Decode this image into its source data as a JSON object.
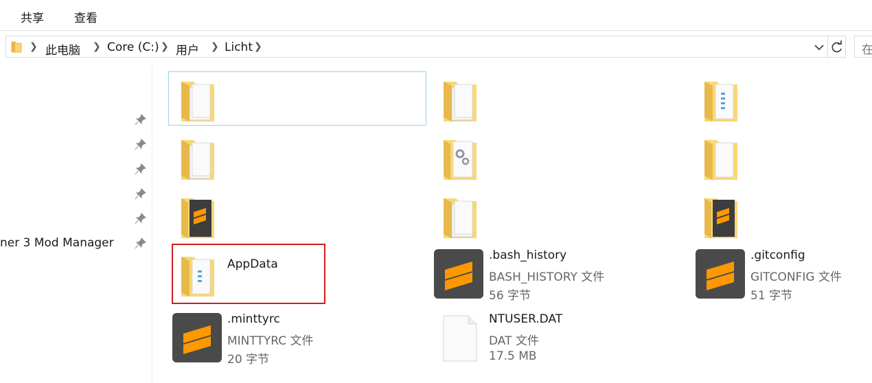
{
  "ribbon": {
    "tabs": [
      "共享",
      "查看"
    ]
  },
  "address": {
    "crumbs": [
      "此电脑",
      "Core (C:)",
      "用户",
      "Licht"
    ],
    "search_placeholder": "在"
  },
  "nav": {
    "visible_item": "ner 3 Mod Manager"
  },
  "files": [
    {
      "name": "AppData",
      "kind": "folder"
    },
    {
      "name": ".bash_history",
      "type": "BASH_HISTORY 文件",
      "size": "56 字节",
      "kind": "sublime"
    },
    {
      "name": ".gitconfig",
      "type": "GITCONFIG 文件",
      "size": "51 字节",
      "kind": "sublime"
    },
    {
      "name": ".minttyrc",
      "type": "MINTTYRC 文件",
      "size": "20 字节",
      "kind": "sublime"
    },
    {
      "name": "NTUSER.DAT",
      "type": "DAT 文件",
      "size": "17.5 MB",
      "kind": "blank"
    }
  ],
  "colors": {
    "folder": "#f8d775",
    "folder_dark": "#e8b94a",
    "sublime_bg": "#4a4a4a",
    "sublime_orange": "#ff9800",
    "selection_border": "#99d1e8",
    "highlight_border": "#d11a1a"
  }
}
